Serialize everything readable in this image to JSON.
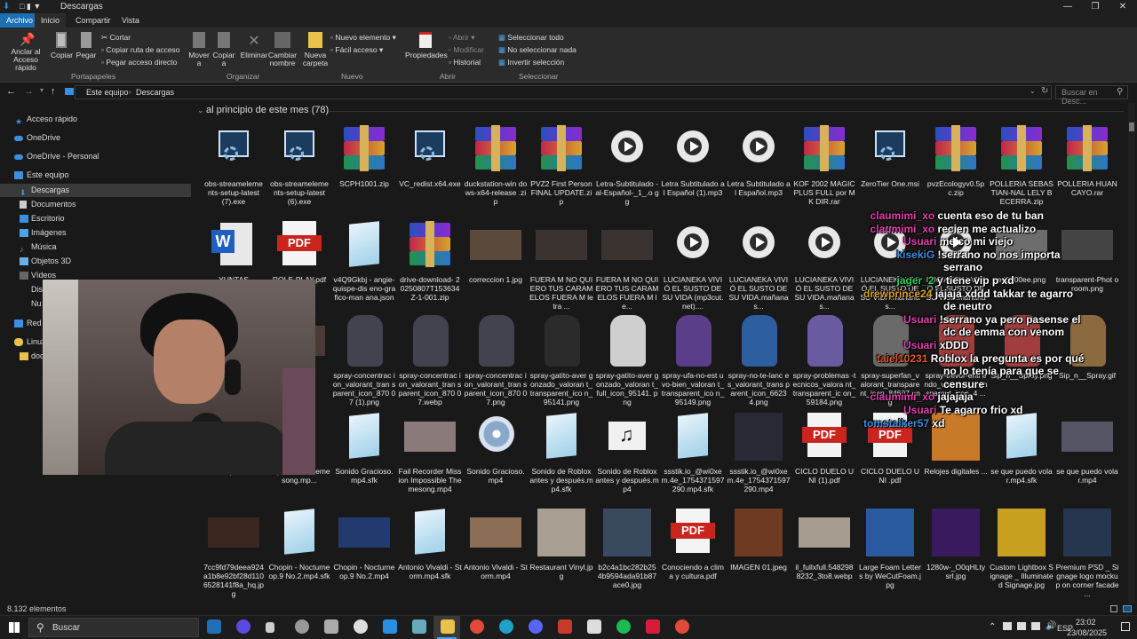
{
  "window": {
    "title": "Descargas",
    "controls": [
      "—",
      "❐",
      "✕"
    ]
  },
  "ribbon_tabs": [
    "Archivo",
    "Inicio",
    "Compartir",
    "Vista"
  ],
  "ribbon": {
    "pin": "Anclar al Acceso rápido",
    "copy": "Copiar",
    "paste": "Pegar",
    "cut": "Cortar",
    "copy_path": "Copiar ruta de acceso",
    "paste_shortcut": "Pegar acceso directo",
    "move_to": "Mover a",
    "copy_to": "Copiar a",
    "delete": "Eliminar",
    "rename": "Cambiar nombre",
    "new_folder": "Nueva carpeta",
    "new_item": "Nuevo elemento",
    "easy_access": "Fácil acceso",
    "properties": "Propiedades",
    "open": "Abrir",
    "edit": "Modificar",
    "history": "Historial",
    "select_all": "Seleccionar todo",
    "select_none": "No seleccionar nada",
    "invert_selection": "Invertir selección",
    "groups": [
      "Portapapeles",
      "Organizar",
      "Nuevo",
      "Abrir",
      "Seleccionar"
    ]
  },
  "address": {
    "crumbs": [
      "Este equipo",
      "Descargas"
    ],
    "search_placeholder": "Buscar en Desc..."
  },
  "nav": [
    "Acceso rápido",
    "OneDrive",
    "OneDrive - Personal",
    "Este equipo",
    "Descargas",
    "Documentos",
    "Escritorio",
    "Imágenes",
    "Música",
    "Objetos 3D",
    "Vídeos",
    "Disc",
    "Nu",
    "Red",
    "Linux",
    "doc"
  ],
  "group_header": "al principio de este mes (78)",
  "rows": [
    [
      {
        "kind": "exe",
        "label": "obs-streameleme nts-setup-latest (7).exe"
      },
      {
        "kind": "exe",
        "label": "obs-streameleme nts-setup-latest (6).exe"
      },
      {
        "kind": "rar",
        "label": "SCPH1001.zip"
      },
      {
        "kind": "exe",
        "label": "VC_redist.x64.exe"
      },
      {
        "kind": "rar",
        "label": "duckstation-win dows-x64-release .zip"
      },
      {
        "kind": "rar",
        "label": "PVZ2 First Person FINAL UPDATE.zip"
      },
      {
        "kind": "play",
        "label": "Letra-Subtitulado -al-Español-_1_.o gg"
      },
      {
        "kind": "play",
        "label": "Letra Subtitulado al Español (1).mp3"
      },
      {
        "kind": "play",
        "label": "Letra Subtitulado al Español.mp3"
      },
      {
        "kind": "rar",
        "label": "KOF 2002 MAGIC PLUS FULL por MK DIR.rar"
      },
      {
        "kind": "exe",
        "label": "ZeroTier One.msi"
      },
      {
        "kind": "rar",
        "label": "pvzEcologyv0.5p c.zip"
      },
      {
        "kind": "rar",
        "label": "POLLERIA SEBASTIAN-NAL LELY BECERRA.zip"
      },
      {
        "kind": "rar",
        "label": "POLLERIA HUANCAYO.rar"
      }
    ],
    [
      {
        "kind": "word",
        "label": "YUNTAS"
      },
      {
        "kind": "pdf",
        "label": "ROLE-PLAY.pdf"
      },
      {
        "kind": "note",
        "label": "v4Q9Gkbj - angie-quispe-dis eno-grafico-man ana.json"
      },
      {
        "kind": "rar",
        "label": "drive-download- 20250807T153634 Z-1-001.zip"
      },
      {
        "kind": "img",
        "c": "#5a4a3e",
        "label": "correccion 1.jpg"
      },
      {
        "kind": "img",
        "c": "#3a3330",
        "label": "FUERA M NO QUIERO TUS CARAMELOS FUERA M letra ..."
      },
      {
        "kind": "img",
        "c": "#3a3330",
        "label": "FUERA M NO QUIERO TUS CARAMELOS FUERA M le..."
      },
      {
        "kind": "play",
        "label": "LUCIANEKA VIVIÓ EL SUSTO DE SU VIDA (mp3cut.net)...."
      },
      {
        "kind": "play",
        "label": "LUCIANEKA VIVIÓ EL SUSTO DE SU VIDA.mañanas..."
      },
      {
        "kind": "play",
        "label": "LUCIANEKA VIVIÓ EL SUSTO DE SU VIDA.mañanas..."
      },
      {
        "kind": "play",
        "label": "LUCIANEKA VIVIÓ EL SUSTO DE SU VIDA.mañanas..."
      },
      {
        "kind": "play",
        "label": "LUCIANEKA VIVIÓ EL SUSTO DE SU VIDA.mañanas..."
      },
      {
        "kind": "img",
        "c": "#6d6d6d",
        "label": "ed0000ee.png"
      },
      {
        "kind": "img",
        "c": "#444",
        "label": "transparent-Phot oroom.png"
      }
    ],
    [
      {
        "kind": "img",
        "c": "#4a3b35",
        "label": "s_1 ...png"
      },
      {
        "kind": "img",
        "c": "#4a3b35",
        "label": "...png"
      },
      {
        "kind": "char",
        "c": "#43434f",
        "label": "spray-concentrac ion_valorant_tran sparent_icon_870 07 (1).png"
      },
      {
        "kind": "char",
        "c": "#43434f",
        "label": "spray-concentrac ion_valorant_tran sparent_icon_870 07.webp"
      },
      {
        "kind": "char",
        "c": "#43434f",
        "label": "spray-concentrac ion_valorant_tran sparent_icon_870 07.png"
      },
      {
        "kind": "char",
        "c": "#2b2b2b",
        "label": "spray-gatito-aver gonzado_valoran t_transparent_ico n_95141.png"
      },
      {
        "kind": "char",
        "c": "#cfcfcf",
        "label": "spray-gatito-aver gonzado_valoran t_full_icon_95141. png"
      },
      {
        "kind": "char",
        "c": "#5a3e8a",
        "label": "spray-ufa-no-est uvo-bien_valoran t_transparent_ico n_95149.png"
      },
      {
        "kind": "char",
        "c": "#2c5ea0",
        "label": "spray-no-te-lanc es_valorant_trans parent_icon_6623 4.png"
      },
      {
        "kind": "char",
        "c": "#6a5aa0",
        "label": "spray-problemas -tecnicos_valora nt_transparent_ic on_59184.png"
      },
      {
        "kind": "char",
        "c": "#6a6a6a",
        "label": "spray-superfan_v alorant_transpare nt_icon_84697.pn g"
      },
      {
        "kind": "char",
        "c": "#a03e3e",
        "label": "spray-trevor-enti endo_valorant_tr ansparent_icon_4 ..."
      },
      {
        "kind": "char",
        "c": "#a03e3e",
        "label": "Sip_n__Spray.png"
      },
      {
        "kind": "char",
        "c": "#8a6a3e",
        "label": "Sip_n__Spray.gif"
      }
    ],
    [
      {
        "kind": "img",
        "c": "#3a3a3a",
        "label": "...mp4.sfk"
      },
      {
        "kind": "note",
        "label": "Impossible Themesong.mp..."
      },
      {
        "kind": "note",
        "label": "Sonido Gracioso.mp4.sfk"
      },
      {
        "kind": "img",
        "c": "#8a7a7a",
        "label": "Fail Recorder Mission Impossible Themesong.mp4"
      },
      {
        "kind": "disc",
        "label": "Sonido Gracioso.mp4"
      },
      {
        "kind": "note",
        "label": "Sonido de Roblox antes y después.mp4.sfk"
      },
      {
        "kind": "speaker",
        "label": "Sonido de Roblox antes y después.mp4"
      },
      {
        "kind": "note",
        "label": "ssstik.io_@wi0xe m.4e_1754371597 290.mp4.sfk"
      },
      {
        "kind": "img2",
        "c": "#2a2a36",
        "label": "ssstik.io_@wi0xe m.4e_1754371597 290.mp4"
      },
      {
        "kind": "pdf",
        "label": "CICLO DUELO UNI (1).pdf"
      },
      {
        "kind": "pdf",
        "label": "CICLO DUELO UNI .pdf"
      },
      {
        "kind": "img2",
        "c": "#c87a28",
        "label": "Relojes digitales ..."
      },
      {
        "kind": "note",
        "label": "se que puedo volar.mp4.sfk"
      },
      {
        "kind": "img",
        "c": "#556",
        "label": "se que puedo volar.mp4"
      }
    ],
    [
      {
        "kind": "img",
        "c": "#3b2620",
        "label": "7cc9fd79deea924 a1b8e92bf28d110 6528141f8a_hq.jp g"
      },
      {
        "kind": "note",
        "label": "Chopin - Nocturne op.9 No.2.mp4.sfk"
      },
      {
        "kind": "img",
        "c": "#233a6e",
        "label": "Chopin - Nocturne op.9 No.2.mp4"
      },
      {
        "kind": "note",
        "label": "Antonio Vivaldi - Storm.mp4.sfk"
      },
      {
        "kind": "img",
        "c": "#8a6e56",
        "label": "Antonio Vivaldi - Storm.mp4"
      },
      {
        "kind": "img2",
        "c": "#a89f92",
        "label": "Restaurant Vinyl.jpg"
      },
      {
        "kind": "img2",
        "c": "#3a4a5e",
        "label": "b2c4a1bc282b25 4b9594ada91b87 ace0.jpg"
      },
      {
        "kind": "pdf",
        "label": "Conociendo a clima y cultura.pdf"
      },
      {
        "kind": "img2",
        "c": "#6e3a22",
        "label": "IMAGEN 01.jpeg"
      },
      {
        "kind": "img",
        "c": "#a79c90",
        "label": "il_fullxfull.548298 8232_3to8.webp"
      },
      {
        "kind": "img2",
        "c": "#2a5aa0",
        "label": "Large Foam Letters by WeCutFoam.jpg"
      },
      {
        "kind": "img2",
        "c": "#3a1a5e",
        "label": "1280w-_O0qHLty srl.jpg"
      },
      {
        "kind": "img2",
        "c": "#c8a020",
        "label": "Custom Lightbox Signage _ Illuminated Signage.jpg"
      },
      {
        "kind": "img2",
        "c": "#26364e",
        "label": "Premium PSD _ Signage logo mockup on corner facade ..."
      }
    ]
  ],
  "status_count": "8.132 elementos",
  "chat": [
    {
      "user": "claumimi_xo",
      "ucolor": "#e63db0",
      "msg": "cuenta eso de tu ban"
    },
    {
      "user": "claumimi_xo",
      "ucolor": "#e63db0",
      "msg": "recien me actualizo"
    },
    {
      "user": "Usuari",
      "ucolor": "#e63db0",
      "msg": "melco mi viejo"
    },
    {
      "user": "kisekiG",
      "ucolor": "#3a8fe0",
      "msg": "!serrano no nos importa"
    },
    {
      "user": "",
      "ucolor": "#fff",
      "msg": "serrano"
    },
    {
      "user": "jager_2",
      "ucolor": "#2fd15a",
      "msg": "y tiene vip p xd"
    },
    {
      "user": "drewprince24",
      "ucolor": "#e0a030",
      "msg": "jajaja xddd takkar te agarro"
    },
    {
      "user": "",
      "ucolor": "#fff",
      "msg": "de neutro"
    },
    {
      "user": "Usuari",
      "ucolor": "#e63db0",
      "msg": "!serrano ya pero pasense el"
    },
    {
      "user": "",
      "ucolor": "#fff",
      "msg": "dc de emma con venom"
    },
    {
      "user": "Usuari",
      "ucolor": "#e63db0",
      "msg": "xDDD"
    },
    {
      "user": "taiel10231",
      "ucolor": "#e05a2a",
      "msg": "Roblox la pregunta es por qué"
    },
    {
      "user": "",
      "ucolor": "#fff",
      "msg": "no lo tenía para que se"
    },
    {
      "user": "",
      "ucolor": "#fff",
      "msg": "censure"
    },
    {
      "user": "claumimi_xo",
      "ucolor": "#e63db0",
      "msg": "jajajaja"
    },
    {
      "user": "Usuari",
      "ucolor": "#e63db0",
      "msg": "Te agarro frio xd"
    },
    {
      "user": "tomstalker57",
      "ucolor": "#3a8fe0",
      "msg": "xd"
    }
  ],
  "taskbar": {
    "search": "Buscar",
    "lang": "ESP",
    "time": "23:02",
    "date": "23/08/2025"
  }
}
